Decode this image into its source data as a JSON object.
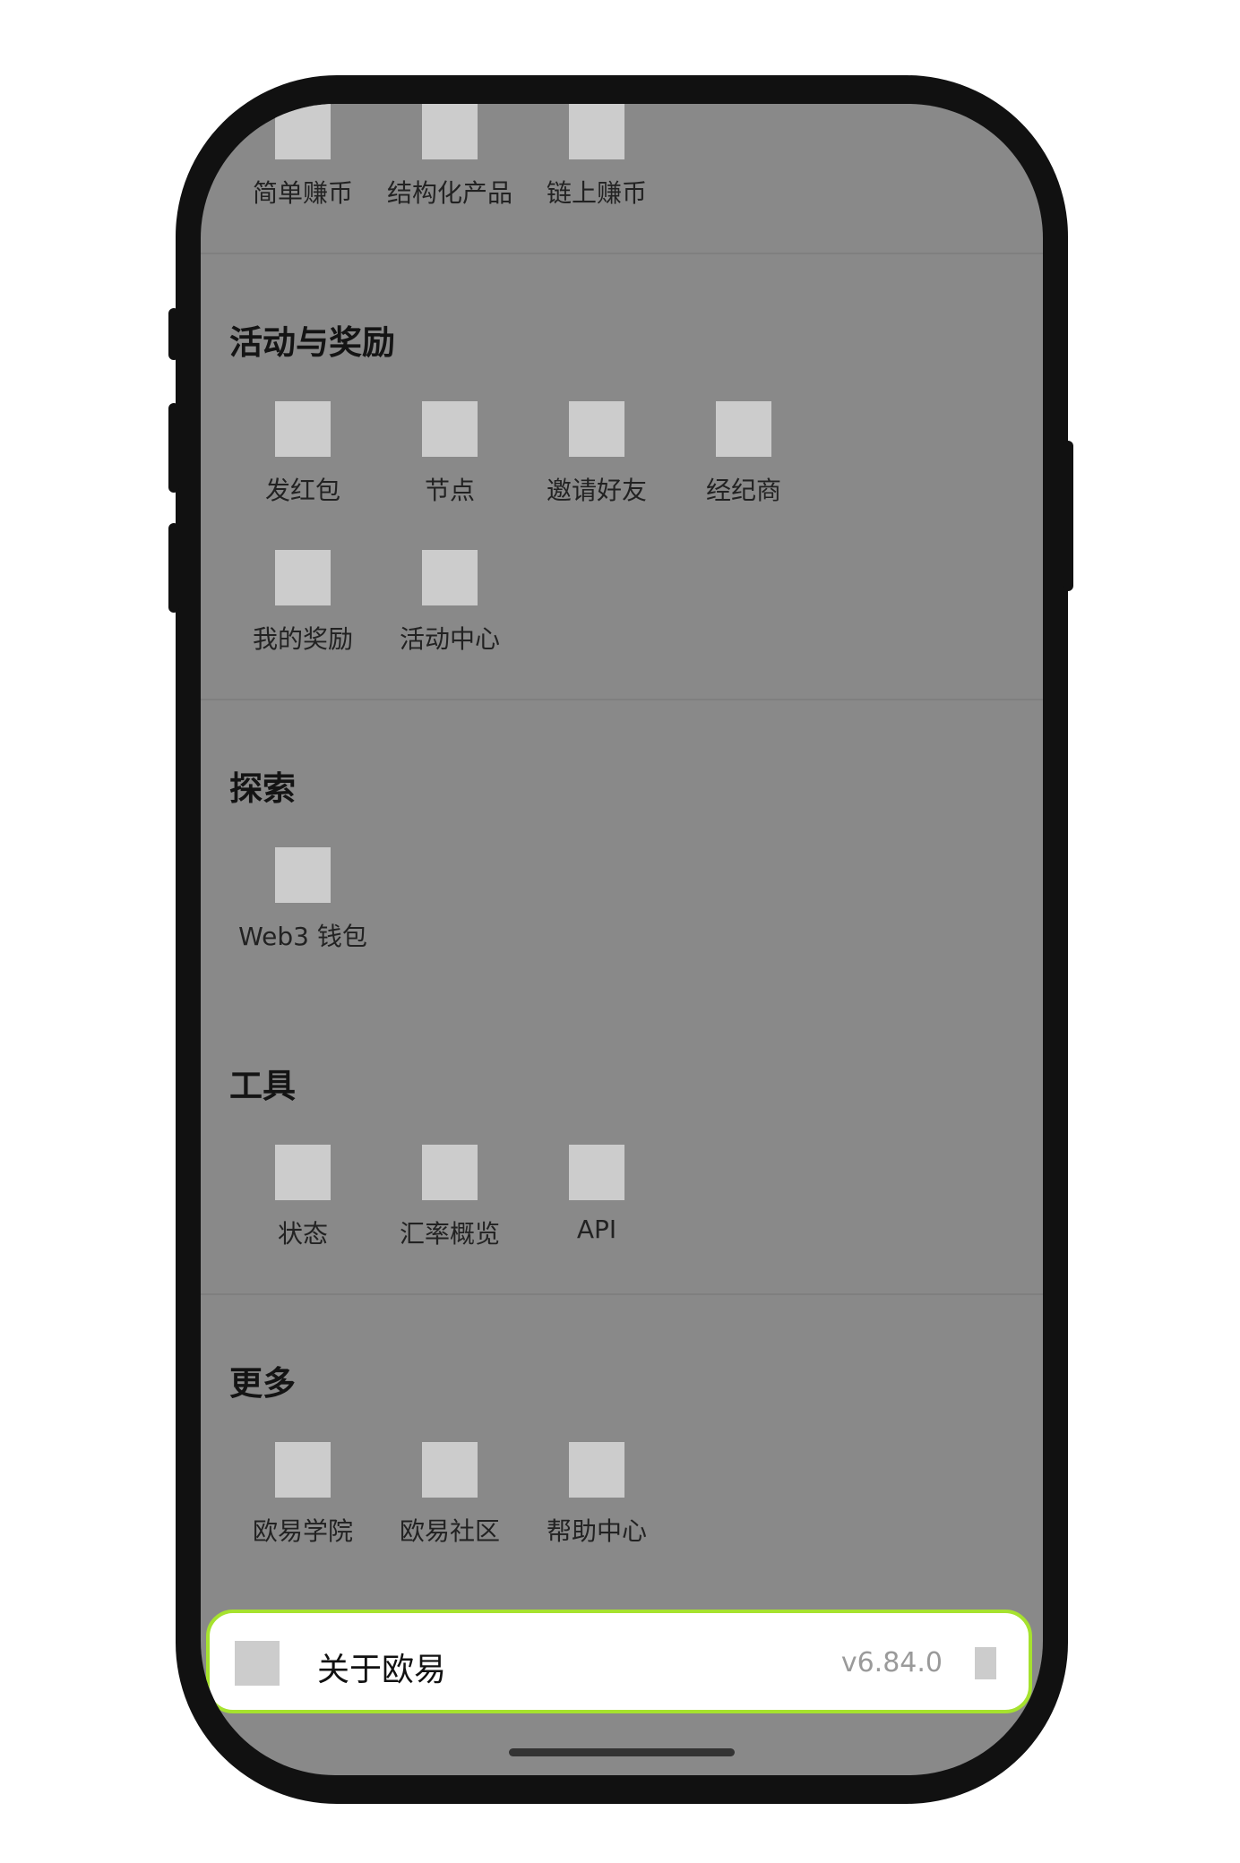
{
  "colors": {
    "screen_overlay": "#898989",
    "highlight_border": "#a6e22e",
    "text_primary": "#141414",
    "version_text": "#9a9a9a"
  },
  "earn_row": {
    "items": [
      {
        "label": "简单赚币",
        "icon": "money-bag-icon"
      },
      {
        "label": "结构化产品",
        "icon": "structured-product-icon"
      },
      {
        "label": "链上赚币",
        "icon": "onchain-nodes-icon"
      }
    ]
  },
  "activities": {
    "title": "活动与奖励",
    "items": [
      {
        "label": "发红包",
        "icon": "red-envelope-icon"
      },
      {
        "label": "节点",
        "icon": "node-hierarchy-icon"
      },
      {
        "label": "邀请好友",
        "icon": "gift-icon"
      },
      {
        "label": "经纪商",
        "icon": "person-icon"
      },
      {
        "label": "我的奖励",
        "icon": "ticket-star-icon"
      },
      {
        "label": "活动中心",
        "icon": "party-popper-icon"
      }
    ]
  },
  "explore": {
    "title": "探索",
    "items": [
      {
        "label": "Web3 钱包",
        "icon": "wallet-icon"
      }
    ]
  },
  "tools": {
    "title": "工具",
    "items": [
      {
        "label": "状态",
        "icon": "status-monitor-icon"
      },
      {
        "label": "汇率概览",
        "icon": "exchange-rate-chart-icon"
      },
      {
        "label": "API",
        "icon": "code-icon"
      }
    ]
  },
  "more": {
    "title": "更多",
    "items": [
      {
        "label": "欧易学院",
        "icon": "graduation-cap-icon"
      },
      {
        "label": "欧易社区",
        "icon": "planet-icon"
      },
      {
        "label": "帮助中心",
        "icon": "help-question-icon"
      }
    ]
  },
  "about": {
    "title": "关于欧易",
    "version": "v6.84.0",
    "icon": "info-icon",
    "chevron": "chevron-right-icon"
  }
}
